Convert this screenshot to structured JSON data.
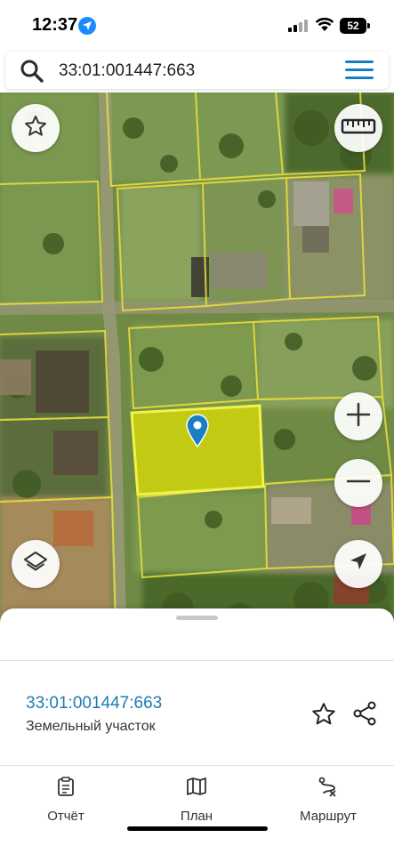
{
  "status_bar": {
    "time": "12:37",
    "battery": "52"
  },
  "search": {
    "query": "33:01:001447:663"
  },
  "map": {
    "icons": {
      "favorite": "star-icon",
      "ruler": "ruler-icon",
      "zoom_in": "plus-icon",
      "zoom_out": "minus-icon",
      "layers": "layers-icon",
      "locate": "navigation-arrow-icon",
      "marker": "location-pin-icon"
    },
    "colors": {
      "parcel_fill": "#e6e600",
      "parcel_border": "#f2f24a",
      "boundary": "#e8dc3c",
      "marker": "#1a7fc1"
    }
  },
  "sheet": {
    "parcel_id": "33:01:001447:663",
    "parcel_type": "Земельный участок"
  },
  "tabs": [
    {
      "label": "Отчёт",
      "icon": "clipboard-icon"
    },
    {
      "label": "План",
      "icon": "map-icon"
    },
    {
      "label": "Маршрут",
      "icon": "route-icon"
    }
  ]
}
